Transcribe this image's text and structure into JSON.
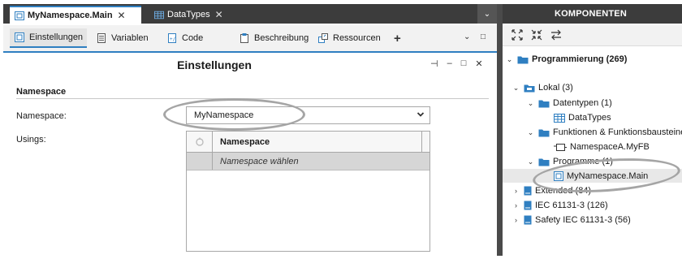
{
  "editor": {
    "tabs": [
      {
        "label": "MyNamespace.Main",
        "close": "✕",
        "icon": "namespace-icon"
      },
      {
        "label": "DataTypes",
        "close": "✕",
        "icon": "table-icon"
      }
    ],
    "tabs_overflow": "⌄"
  },
  "toolbar": {
    "buttons": [
      {
        "label": "Einstellungen",
        "icon": "settings-page-icon"
      },
      {
        "label": "Variablen",
        "icon": "variables-icon"
      },
      {
        "label": "Code",
        "icon": "code-icon"
      },
      {
        "label": "Beschreibung",
        "icon": "clipboard-icon"
      },
      {
        "label": "Ressourcen",
        "icon": "resources-icon"
      }
    ],
    "add": "+",
    "collapse": "⌄",
    "maximize": "□"
  },
  "panel": {
    "title": "Einstellungen",
    "pin": "⊣",
    "minimize": "–",
    "maximize": "□",
    "close": "✕"
  },
  "namespace_section": {
    "heading": "Namespace",
    "namespace_label": "Namespace:",
    "namespace_value": "MyNamespace",
    "usings_label": "Usings:",
    "grid": {
      "column": "Namespace",
      "placeholder_row": "Namespace wählen"
    }
  },
  "components": {
    "title": "KOMPONENTEN",
    "tree": [
      {
        "label": "Programmierung (269)",
        "level": 0,
        "expanded": true,
        "bold": true,
        "icon": "folder-icon"
      },
      {
        "label": "Lokal (3)",
        "level": 1,
        "expanded": true,
        "icon": "library-icon"
      },
      {
        "label": "Datentypen (1)",
        "level": 2,
        "expanded": true,
        "icon": "folder-icon"
      },
      {
        "label": "DataTypes",
        "level": 3,
        "icon": "table-icon"
      },
      {
        "label": "Funktionen & Funktionsbausteine",
        "level": 2,
        "expanded": true,
        "icon": "folder-icon"
      },
      {
        "label": "NamespaceA.MyFB",
        "level": 3,
        "icon": "function-block-icon"
      },
      {
        "label": "Programme (1)",
        "level": 2,
        "expanded": true,
        "icon": "folder-icon"
      },
      {
        "label": "MyNamespace.Main",
        "level": 3,
        "selected": true,
        "icon": "namespace-icon"
      },
      {
        "label": "Extended (84)",
        "level": 1,
        "expanded": false,
        "icon": "book-icon"
      },
      {
        "label": "IEC 61131-3 (126)",
        "level": 1,
        "expanded": false,
        "icon": "book-icon"
      },
      {
        "label": "Safety IEC 61131-3 (56)",
        "level": 1,
        "expanded": false,
        "icon": "book-icon"
      }
    ]
  },
  "colors": {
    "accent": "#2f7fc1",
    "dark_header": "#3c3c3c",
    "folder": "#2f7fc1",
    "highlight_ellipse": "#a5a5a5"
  }
}
